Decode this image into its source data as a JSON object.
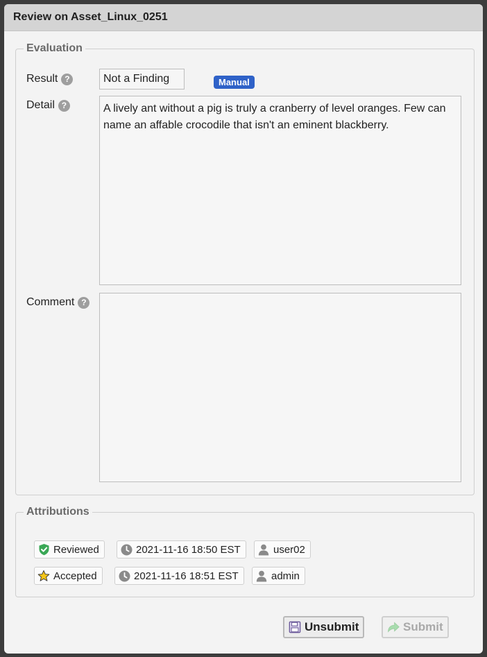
{
  "window": {
    "title": "Review on Asset_Linux_0251"
  },
  "evaluation": {
    "legend": "Evaluation",
    "result_label": "Result",
    "result_value": "Not a Finding",
    "source_badge": "Manual",
    "detail_label": "Detail",
    "detail_text": "A lively ant without a pig is truly a cranberry of level oranges. Few can name an affable crocodile that isn't an eminent blackberry.",
    "comment_label": "Comment",
    "comment_text": ""
  },
  "attributions": {
    "legend": "Attributions",
    "rows": [
      {
        "status": "Reviewed",
        "status_icon": "shield-check-icon",
        "timestamp": "2021-11-16 18:50 EST",
        "user": "user02"
      },
      {
        "status": "Accepted",
        "status_icon": "star-icon",
        "timestamp": "2021-11-16 18:51 EST",
        "user": "admin"
      }
    ]
  },
  "actions": {
    "unsubmit_label": "Unsubmit",
    "submit_label": "Submit",
    "submit_enabled": false
  },
  "colors": {
    "badge": "#2f62c8",
    "reviewed": "#3aa856",
    "accepted": "#f5c518"
  }
}
